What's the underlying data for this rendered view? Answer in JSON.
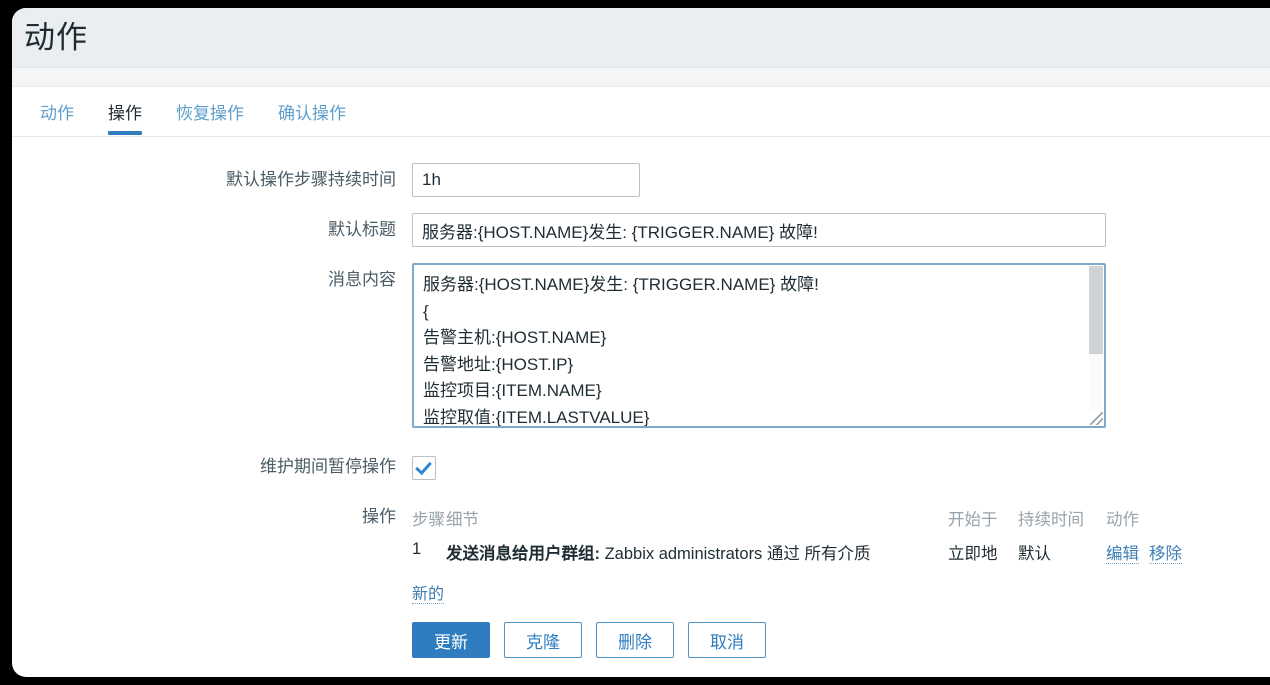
{
  "window": {
    "title": "动作"
  },
  "tabs": [
    {
      "label": "动作",
      "active": false
    },
    {
      "label": "操作",
      "active": true
    },
    {
      "label": "恢复操作",
      "active": false
    },
    {
      "label": "确认操作",
      "active": false
    }
  ],
  "form": {
    "default_duration": {
      "label": "默认操作步骤持续时间",
      "value": "1h"
    },
    "default_subject": {
      "label": "默认标题",
      "value": "服务器:{HOST.NAME}发生: {TRIGGER.NAME} 故障!"
    },
    "message_body": {
      "label": "消息内容",
      "value": "服务器:{HOST.NAME}发生: {TRIGGER.NAME} 故障!\n{\n告警主机:{HOST.NAME}\n告警地址:{HOST.IP}\n监控项目:{ITEM.NAME}\n监控取值:{ITEM.LASTVALUE}"
    },
    "pause_maintenance": {
      "label": "维护期间暂停操作",
      "checked": true
    },
    "operations": {
      "label": "操作",
      "headers": {
        "step": "步骤",
        "details": "细节",
        "start_in": "开始于",
        "duration": "持续时间",
        "action": "动作"
      },
      "rows": [
        {
          "step": "1",
          "detail_bold": "发送消息给用户群组:",
          "detail_rest": " Zabbix administrators 通过 所有介质",
          "start_in": "立即地",
          "duration": "默认",
          "edit_label": "编辑",
          "remove_label": "移除"
        }
      ],
      "new_label": "新的"
    }
  },
  "footer": {
    "update_label": "更新",
    "clone_label": "克隆",
    "delete_label": "删除",
    "cancel_label": "取消"
  },
  "colors": {
    "accent": "#2f7dbf",
    "link": "#3f7fb4",
    "header_bg": "#ebeef0"
  }
}
